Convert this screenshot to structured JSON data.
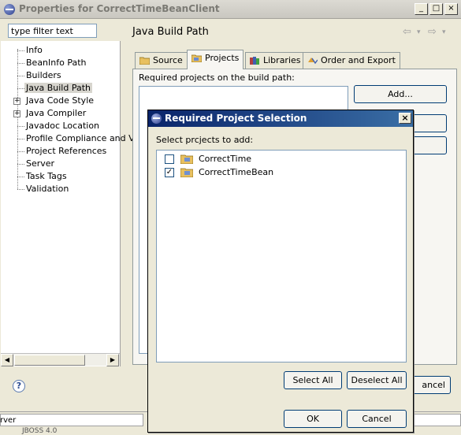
{
  "window": {
    "title": "Properties for CorrectTimeBeanClient",
    "min_glyph": "_",
    "max_glyph": "□",
    "close_glyph": "×"
  },
  "filter": {
    "placeholder": "type filter text",
    "value": "type filter text"
  },
  "tree": {
    "items": [
      {
        "label": "Info"
      },
      {
        "label": "BeanInfo Path"
      },
      {
        "label": "Builders"
      },
      {
        "label": "Java Build Path",
        "selected": true
      },
      {
        "label": "Java Code Style",
        "expandable": true
      },
      {
        "label": "Java Compiler",
        "expandable": true
      },
      {
        "label": "Javadoc Location"
      },
      {
        "label": "Profile Compliance and Va"
      },
      {
        "label": "Project References"
      },
      {
        "label": "Server"
      },
      {
        "label": "Task Tags"
      },
      {
        "label": "Validation"
      }
    ],
    "expand_glyph": "+",
    "scroll_left_glyph": "◀",
    "scroll_right_glyph": "▶"
  },
  "page": {
    "title": "Java Build Path",
    "back_glyph": "⇦",
    "forward_glyph": "⇨",
    "menu_glyph": "▾"
  },
  "tabs": [
    {
      "label": "Source"
    },
    {
      "label": "Projects",
      "active": true
    },
    {
      "label": "Libraries"
    },
    {
      "label": "Order and Export"
    }
  ],
  "projects_page": {
    "required_label": "Required projects on the build path:",
    "add_button": "Add...",
    "cancel_partial": "ancel"
  },
  "help": {
    "glyph": "?"
  },
  "status": {
    "left_text": "rver",
    "bottom_text": "JBOSS 4.0"
  },
  "dialog": {
    "title": "Required Project Selection",
    "close_glyph": "×",
    "select_label": "Select prcjects to add:",
    "projects": [
      {
        "name": "CorrectTime",
        "checked": false
      },
      {
        "name": "CorrectTimeBean",
        "checked": true
      }
    ],
    "check_glyph": "✓",
    "select_all": "Select All",
    "deselect_all": "Deselect All",
    "ok": "OK",
    "cancel": "Cancel"
  },
  "colors": {
    "dialog_title_start": "#0a246a",
    "dialog_title_end": "#3a6ea5",
    "face": "#ece9d8",
    "folder": "#e8c060"
  }
}
